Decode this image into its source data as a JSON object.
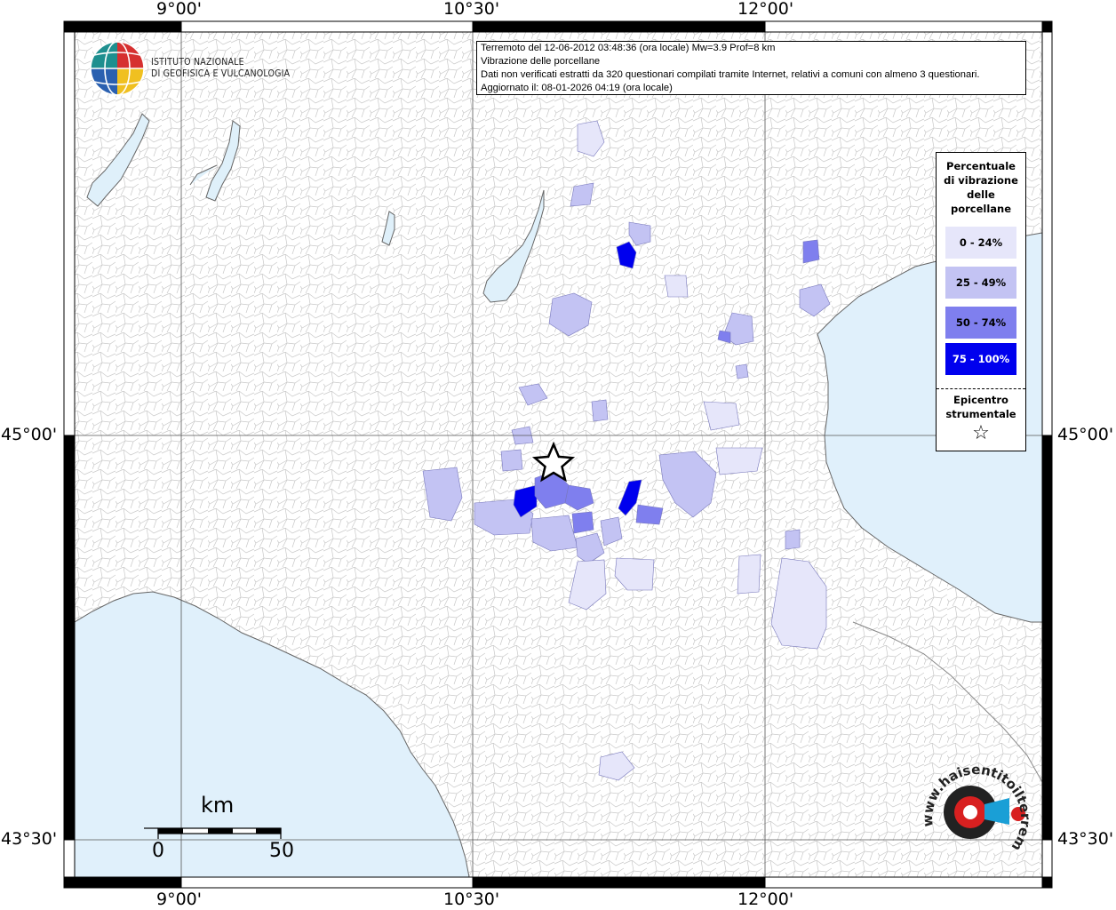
{
  "header": {
    "institute_line1": "ISTITUTO NAZIONALE",
    "institute_line2": "DI GEOFISICA E VULCANOLOGIA"
  },
  "info": {
    "line1": "Terremoto del 12-06-2012 03:48:36 (ora locale) Mw=3.9 Prof=8 km",
    "line2": "Vibrazione delle porcellane",
    "line3": "Dati non verificati estratti da 320 questionari compilati tramite Internet, relativi a comuni con almeno 3 questionari.",
    "line4": "Aggiornato il: 08-01-2026 04:19 (ora locale)"
  },
  "coords": {
    "lon_1": "9°00'",
    "lon_2": "10°30'",
    "lon_3": "12°00'",
    "lat_1": "45°00'",
    "lat_2": "43°30'"
  },
  "legend": {
    "title_l1": "Percentuale",
    "title_l2": "di vibrazione",
    "title_l3": "delle",
    "title_l4": "porcellane",
    "items": [
      {
        "label": "0 - 24%",
        "color": "#e6e6fa"
      },
      {
        "label": "25 - 49%",
        "color": "#c3c3f3"
      },
      {
        "label": "50 - 74%",
        "color": "#7f7fee"
      },
      {
        "label": "75 - 100%",
        "color": "#0000ee"
      }
    ],
    "epicenter_l1": "Epicentro",
    "epicenter_l2": "strumentale",
    "epicenter_symbol": "☆"
  },
  "scale": {
    "unit": "km",
    "start": "0",
    "end": "50"
  },
  "watermark": {
    "text": "www.haisentitoilterremoto.it"
  },
  "colors": {
    "sea": "#e0f0fb",
    "land": "#ffffff",
    "border": "#bbbbbb"
  }
}
